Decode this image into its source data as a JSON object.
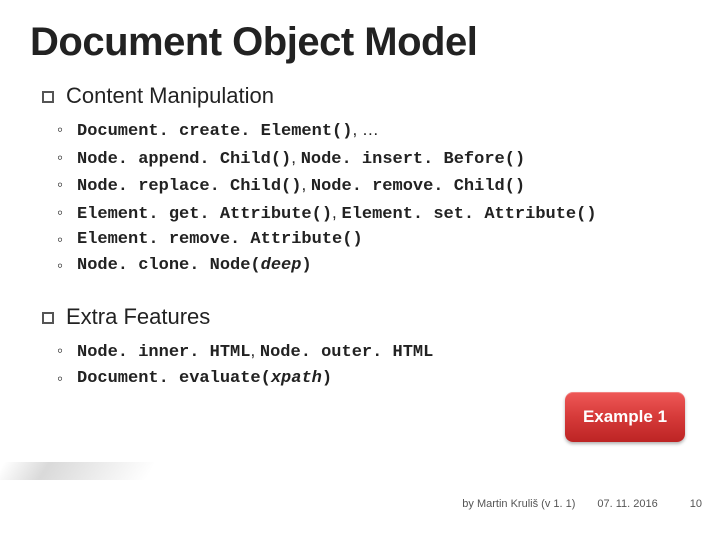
{
  "title": "Document Object Model",
  "sections": [
    {
      "head_prefix": "Content",
      "head_rest": " Manipulation",
      "items": [
        {
          "parts": [
            {
              "t": "Document. create. Element()",
              "cls": "mono"
            },
            {
              "t": ", …",
              "cls": "ellips"
            }
          ]
        },
        {
          "parts": [
            {
              "t": "Node. append. Child()",
              "cls": "mono"
            },
            {
              "t": ", ",
              "cls": "ellips"
            },
            {
              "t": "Node. insert. Before()",
              "cls": "mono"
            }
          ]
        },
        {
          "parts": [
            {
              "t": "Node. replace. Child()",
              "cls": "mono"
            },
            {
              "t": ", ",
              "cls": "ellips"
            },
            {
              "t": "Node. remove. Child()",
              "cls": "mono"
            }
          ]
        },
        {
          "parts": [
            {
              "t": "Element. get. Attribute()",
              "cls": "mono"
            },
            {
              "t": ", ",
              "cls": "ellips"
            },
            {
              "t": "Element. set. Attribute()",
              "cls": "mono"
            }
          ]
        },
        {
          "parts": [
            {
              "t": "Element. remove. Attribute()",
              "cls": "mono"
            }
          ]
        },
        {
          "parts": [
            {
              "t": "Node. clone. Node(",
              "cls": "mono"
            },
            {
              "t": "deep",
              "cls": "mono italic-arg"
            },
            {
              "t": ")",
              "cls": "mono"
            }
          ]
        }
      ]
    },
    {
      "head_prefix": "Extra",
      "head_rest": " Features",
      "items": [
        {
          "parts": [
            {
              "t": "Node. inner. HTML",
              "cls": "mono"
            },
            {
              "t": ", ",
              "cls": "ellips"
            },
            {
              "t": "Node. outer. HTML",
              "cls": "mono"
            }
          ]
        },
        {
          "parts": [
            {
              "t": "Document. evaluate(",
              "cls": "mono"
            },
            {
              "t": "xpath",
              "cls": "mono italic-arg"
            },
            {
              "t": ")",
              "cls": "mono"
            }
          ]
        }
      ]
    }
  ],
  "example_button": "Example 1",
  "footer": {
    "author": "by Martin Kruliš (v 1. 1)",
    "date": "07. 11. 2016",
    "pageno": "10"
  }
}
